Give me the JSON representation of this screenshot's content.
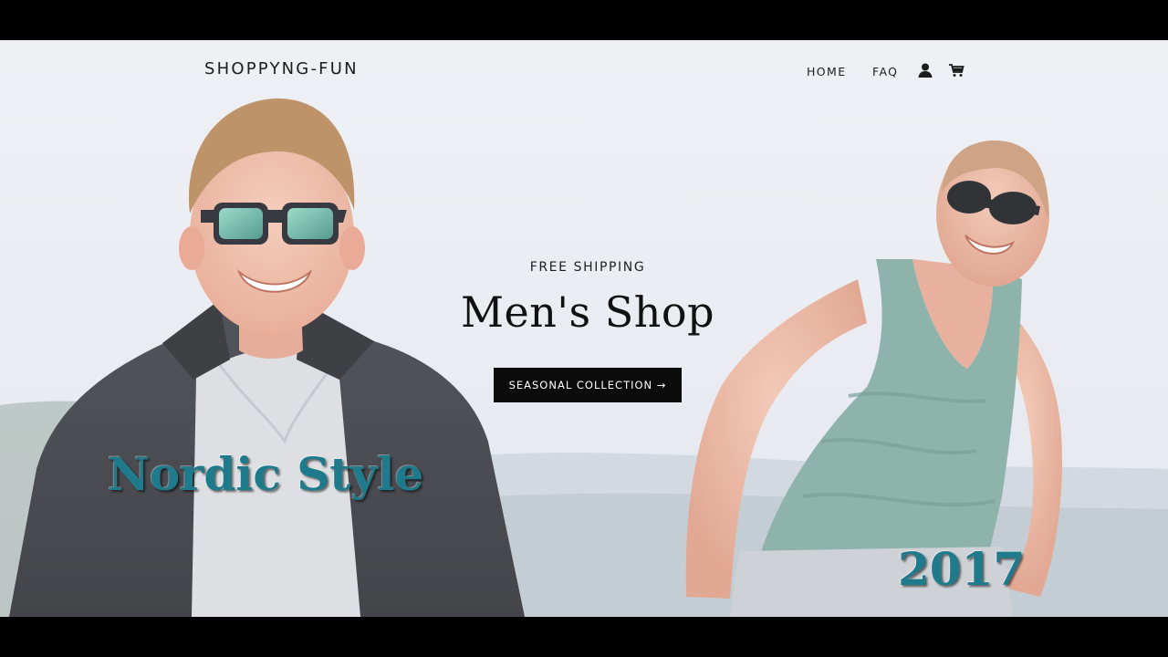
{
  "header": {
    "logo": "SHOPPYNG-FUN",
    "nav": [
      "HOME",
      "FAQ"
    ],
    "icons": [
      "account-icon",
      "cart-icon"
    ]
  },
  "hero": {
    "eyebrow": "FREE SHIPPING",
    "title": "Men's Shop",
    "cta_label": "SEASONAL COLLECTION →"
  },
  "overlay": {
    "left_caption": "Nordic Style",
    "right_caption": "2017",
    "caption_color": "#1f7a8c"
  },
  "colors": {
    "accent_button": "#0b0b0b",
    "text": "#1c1c1c"
  }
}
